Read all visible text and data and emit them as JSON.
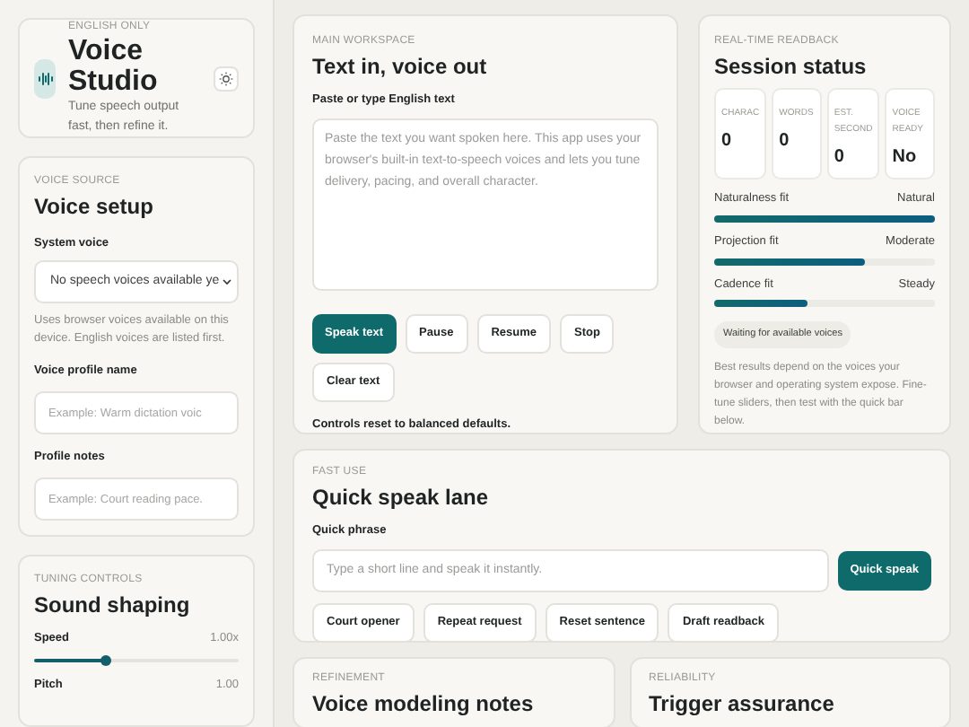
{
  "brand": {
    "eyebrow": "ENGLISH ONLY",
    "title": "Voice Studio",
    "subtitle": "Tune speech output fast, then refine it."
  },
  "voice_setup": {
    "eyebrow": "VOICE SOURCE",
    "title": "Voice setup",
    "fields": [
      {
        "kind": "select",
        "label": "System voice",
        "value": "No speech voices available ye",
        "help": "Uses browser voices available on this device. English voices are listed first."
      },
      {
        "kind": "input",
        "label": "Voice profile name",
        "placeholder": "Example: Warm dictation voic"
      },
      {
        "kind": "input",
        "label": "Profile notes",
        "placeholder": "Example: Court reading pace."
      }
    ]
  },
  "sound_shaping": {
    "eyebrow": "TUNING CONTROLS",
    "title": "Sound shaping",
    "sliders": [
      {
        "label": "Speed",
        "reading": "1.00x",
        "level": 0.35
      },
      {
        "label": "Pitch",
        "reading": "1.00"
      }
    ]
  },
  "workspace": {
    "eyebrow": "MAIN WORKSPACE",
    "title": "Text in, voice out",
    "field_label": "Paste or type English text",
    "placeholder": "Paste the text you want spoken here. This app uses your browser's built-in text-to-speech voices and lets you tune delivery, pacing, and overall character.",
    "buttons": [
      {
        "label": "Speak text",
        "primary": true
      },
      {
        "label": "Pause",
        "primary": false
      },
      {
        "label": "Resume",
        "primary": false
      },
      {
        "label": "Stop",
        "primary": false
      },
      {
        "label": "Clear text",
        "primary": false
      }
    ],
    "status": "Controls reset to balanced defaults."
  },
  "session": {
    "eyebrow": "REAL-TIME READBACK",
    "title": "Session status",
    "stats": [
      {
        "label": "CHARAC",
        "value": "0"
      },
      {
        "label": "WORDS",
        "value": "0"
      },
      {
        "label": "EST. SECOND",
        "value": "0"
      },
      {
        "label": "VOICE READY",
        "value": "No"
      }
    ],
    "meters": [
      {
        "label": "Naturalness fit",
        "reading": "Natural",
        "level": 1.0
      },
      {
        "label": "Projection fit",
        "reading": "Moderate",
        "level": 0.68
      },
      {
        "label": "Cadence fit",
        "reading": "Steady",
        "level": 0.42
      }
    ],
    "badge": "Waiting for available voices",
    "note": "Best results depend on the voices your browser and operating system expose. Fine-tune sliders, then test with the quick bar below."
  },
  "quick": {
    "eyebrow": "FAST USE",
    "title": "Quick speak lane",
    "field_label": "Quick phrase",
    "placeholder": "Type a short line and speak it instantly.",
    "button": "Quick speak",
    "presets": [
      "Court opener",
      "Repeat request",
      "Reset sentence",
      "Draft readback"
    ]
  },
  "bottom_cards": [
    {
      "eyebrow": "REFINEMENT",
      "title": "Voice modeling notes"
    },
    {
      "eyebrow": "RELIABILITY",
      "title": "Trigger assurance"
    }
  ]
}
